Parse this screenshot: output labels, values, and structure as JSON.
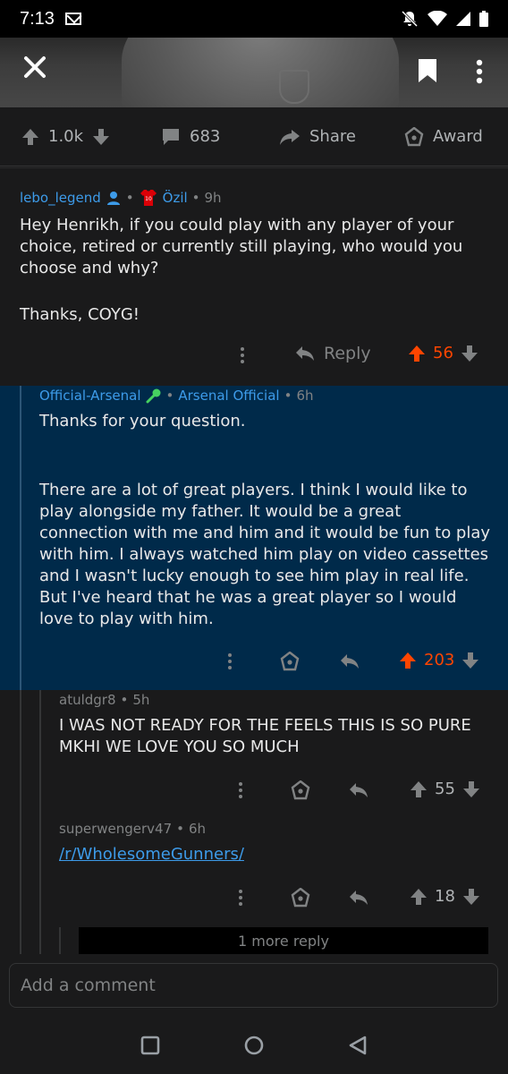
{
  "status": {
    "time": "7:13"
  },
  "post_stats": {
    "votes": "1.0k",
    "comments": "683",
    "share": "Share",
    "award": "Award"
  },
  "comment1": {
    "author": "lebo_legend",
    "flair": "Özil",
    "time": "9h",
    "body_p1": "Hey Henrikh, if you could play with any player of your choice, retired or currently still playing, who would you choose and why?",
    "body_p2": "Thanks, COYG!",
    "reply_label": "Reply",
    "score": "56"
  },
  "comment2": {
    "author": "Official-Arsenal",
    "flair": "Arsenal Official",
    "time": "6h",
    "body_p1": "Thanks for your question.",
    "body_p2": "There are a lot of great players. I think I would like to play alongside my father. It would be a great connection with me and him and it would be fun to play with him. I always watched him play on video cassettes and I wasn't lucky enough to see him play in real life. But I've heard that he was a great player so I would love to play with him.",
    "score": "203"
  },
  "comment3": {
    "author": "atuldgr8",
    "time": "5h",
    "body": "I WAS NOT READY FOR THE FEELS THIS IS SO PURE MKHI WE LOVE YOU SO MUCH",
    "score": "55"
  },
  "comment4": {
    "author": "superwengerv47",
    "time": "6h",
    "link": "/r/WholesomeGunners/",
    "score": "18"
  },
  "more_replies": "1 more reply",
  "composer": {
    "placeholder": "Add a comment"
  },
  "colors": {
    "upvote": "#ff4500",
    "official_bg": "#002a4a",
    "link": "#0079d3"
  }
}
